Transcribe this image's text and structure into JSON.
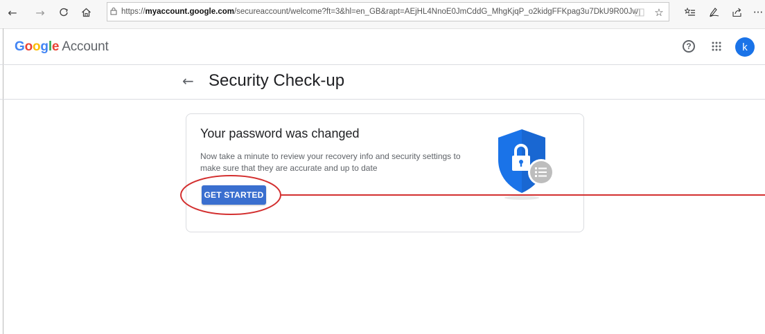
{
  "browser": {
    "url_prefix": "https://",
    "url_domain": "myaccount.google.com",
    "url_rest": "/secureaccount/welcome?ft=3&hl=en_GB&rapt=AEjHL4NnoE0JmCddG_MhgKjqP_o2kidgFFKpag3u7DkU9R00Jw"
  },
  "header": {
    "logo_letters": [
      {
        "ch": "G",
        "color": "#4285F4"
      },
      {
        "ch": "o",
        "color": "#EA4335"
      },
      {
        "ch": "o",
        "color": "#FBBC05"
      },
      {
        "ch": "g",
        "color": "#4285F4"
      },
      {
        "ch": "l",
        "color": "#34A853"
      },
      {
        "ch": "e",
        "color": "#EA4335"
      }
    ],
    "account_label": "Account",
    "help_glyph": "?",
    "avatar_initial": "k"
  },
  "page": {
    "back_glyph": "←",
    "title": "Security Check-up"
  },
  "card": {
    "title": "Your password was changed",
    "description": "Now take a minute to review your recovery info and security settings to make sure that they are accurate and up to date",
    "button_label": "GET STARTED"
  },
  "colors": {
    "accent": "#3a6fcf",
    "shield": "#1a73e8",
    "annotation": "#d32f2f"
  },
  "icons": {
    "back": "back-arrow-icon",
    "forward": "forward-arrow-icon",
    "refresh": "refresh-icon",
    "home": "home-icon",
    "lock": "lock-icon",
    "reading_view": "reading-view-icon",
    "favorite": "star-icon",
    "favorites_list": "favorites-list-icon",
    "pen": "pen-icon",
    "share": "share-icon",
    "more": "more-icon",
    "apps": "apps-grid-icon",
    "help": "help-icon"
  }
}
